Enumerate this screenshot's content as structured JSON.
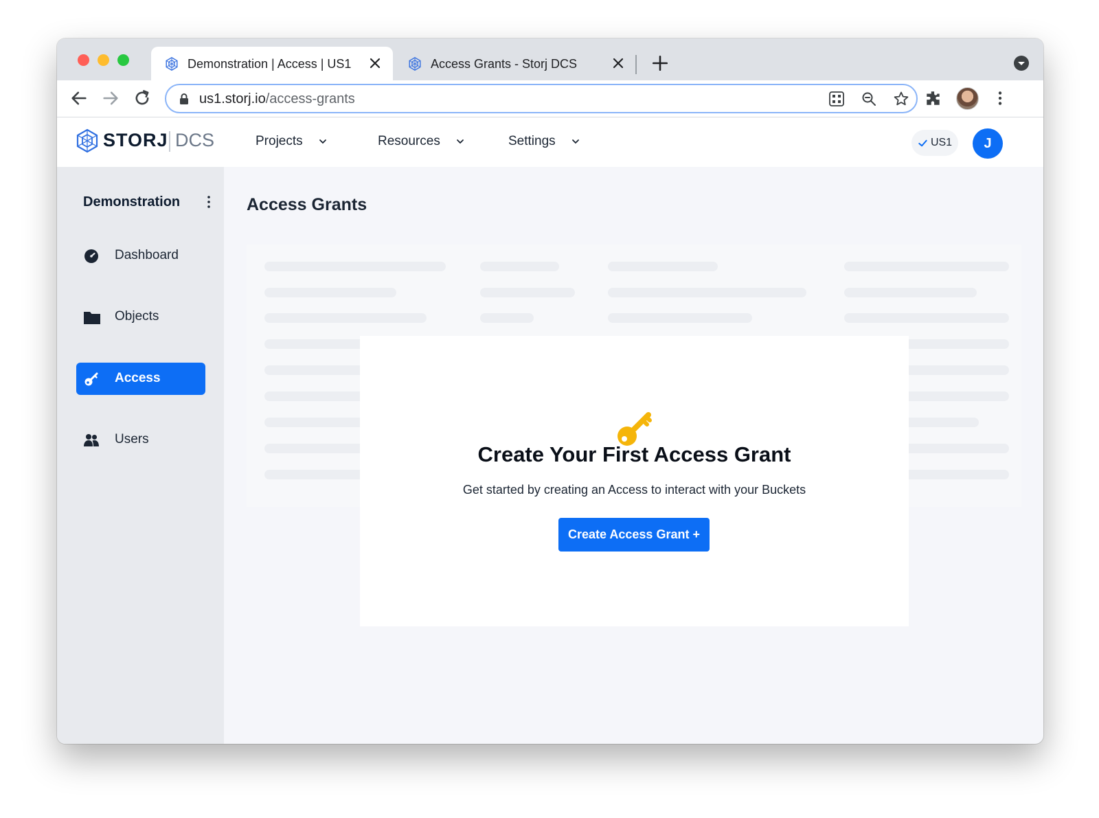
{
  "browser": {
    "tabs": [
      {
        "title": "Demonstration | Access | US1",
        "active": true
      },
      {
        "title": "Access Grants - Storj DCS",
        "active": false
      }
    ],
    "url_host": "us1.storj.io",
    "url_path": "/access-grants",
    "icons": [
      "back-icon",
      "forward-icon",
      "reload-icon",
      "lock-icon",
      "qr-code-icon",
      "zoom-icon",
      "star-icon",
      "extensions-icon",
      "profile-avatar",
      "chrome-menu-icon",
      "new-tab-icon",
      "tab-search-icon"
    ]
  },
  "header": {
    "logo_text": "STORJ",
    "logo_sub": "DCS",
    "nav": [
      {
        "label": "Projects"
      },
      {
        "label": "Resources"
      },
      {
        "label": "Settings"
      }
    ],
    "region": "US1",
    "avatar_initial": "J"
  },
  "sidebar": {
    "project_name": "Demonstration",
    "items": [
      {
        "label": "Dashboard",
        "icon": "dashboard-icon",
        "active": false
      },
      {
        "label": "Objects",
        "icon": "folder-icon",
        "active": false
      },
      {
        "label": "Access",
        "icon": "key-icon",
        "active": true
      },
      {
        "label": "Users",
        "icon": "users-icon",
        "active": false
      }
    ]
  },
  "main": {
    "title": "Access Grants",
    "empty_state": {
      "icon": "key-icon",
      "title": "Create Your First Access Grant",
      "subtitle": "Get started by creating an Access to interact with your Buckets",
      "button_label": "Create Access Grant +"
    }
  },
  "colors": {
    "primary": "#0d6ef5",
    "sidebar_bg": "#e8eaee",
    "key_gold": "#f5b50a"
  }
}
